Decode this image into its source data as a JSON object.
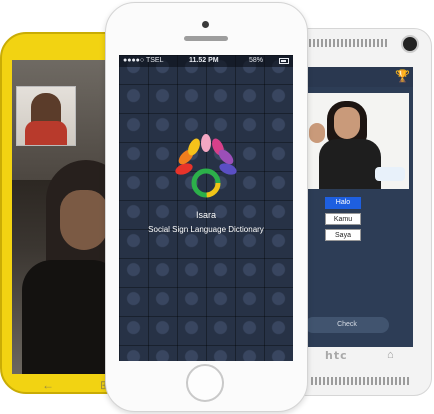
{
  "center_phone": {
    "status_bar": {
      "carrier": "●●●●○ TSEL",
      "time": "11.52 PM",
      "battery": "58%"
    },
    "app_name": "Isara",
    "tagline": "Social Sign Language Dictionary"
  },
  "right_phone": {
    "brand": "htc",
    "options": [
      "Halo",
      "Kamu",
      "Saya"
    ],
    "selected_option": "Halo",
    "check_button": "Check"
  },
  "colors": {
    "left_phone_body": "#f2d312",
    "center_screen": "#1f2837",
    "right_screen": "#2d3d56",
    "selected_option": "#1e5fe0"
  },
  "icons": {
    "back": "back-arrow-icon",
    "windows": "windows-logo-icon",
    "trophy": "trophy-icon",
    "home": "home-icon"
  }
}
